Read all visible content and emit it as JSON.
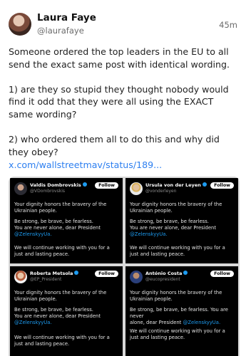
{
  "post": {
    "author_name": "Laura Faye",
    "author_handle": "@laurafaye",
    "timestamp": "45m",
    "body": "Someone ordered the top leaders in the EU to all send the exact same post with identical wording.\n\n1) are they so stupid they thought nobody would find it odd that they were all using the EXACT same wording?\n\n2) who ordered them all to do this and why did they obey?",
    "link": "x.com/wallstreetmav/status/189..."
  },
  "embed": {
    "cards": [
      {
        "name": "Valdis Dombrovskis",
        "handle": "@VDombrovskis",
        "follow": "Follow",
        "p1": "Your dignity honors the bravery of the Ukrainian people.",
        "p2a": "Be strong, be brave, be fearless.",
        "p2b": "You are never alone, dear President",
        "mention": "@ZelenskyyUa.",
        "p3": "We will continue working with you for a just and lasting peace."
      },
      {
        "name": "Ursula von der Leyen",
        "handle": "@vonderleyen",
        "follow": "Follow",
        "p1": "Your dignity honors the bravery of the Ukrainian people.",
        "p2a": "Be strong, be brave, be fearless.",
        "p2b": "You are never alone, dear President",
        "mention": "@ZelenskyyUa.",
        "p3": "We will continue working with you for a just and lasting peace."
      },
      {
        "name": "Roberta Metsola",
        "handle": "@EP_President",
        "follow": "Follow",
        "p1": "Your dignity honors the bravery of the Ukrainian people.",
        "p2a": "Be strong, be brave, be fearless.",
        "p2b": "You are never alone, dear President",
        "mention": "@ZelenskyyUa.",
        "p3": "We will continue working with you for a just and lasting peace."
      },
      {
        "name": "António Costa",
        "handle": "@eucopresident",
        "follow": "Follow",
        "p1": "Your dignity honors the bravery of the Ukrainian people.",
        "p2a": "Be strong, be brave, be fearless. You are never",
        "p2b": "alone, dear President",
        "mention": "@ZelenskyyUa.",
        "p3": "We will continue working with you for a just and lasting peace."
      }
    ]
  }
}
